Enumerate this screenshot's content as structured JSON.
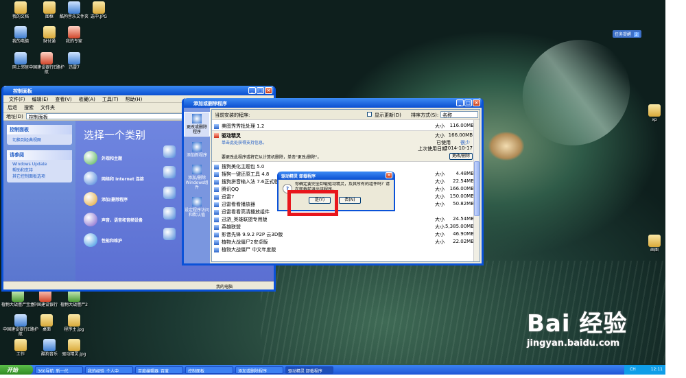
{
  "desktop_icons": [
    {
      "label": "我的文档",
      "tone": ""
    },
    {
      "label": "图框",
      "tone": ""
    },
    {
      "label": "酷狗音乐文件夹",
      "tone": "b"
    },
    {
      "label": "选中.JPG",
      "tone": ""
    },
    {
      "label": "我的电脑",
      "tone": "b"
    },
    {
      "label": "财付通",
      "tone": ""
    },
    {
      "label": "我的专家",
      "tone": "r"
    },
    {
      "label": "网上邻居",
      "tone": "b"
    },
    {
      "label": "中国建设银行E路护航",
      "tone": "r"
    },
    {
      "label": "迅雷7",
      "tone": "b"
    },
    {
      "label": "植物大战僵尸宝盒",
      "tone": "g"
    },
    {
      "label": "中国建设银行",
      "tone": "r"
    },
    {
      "label": "植物大战僵尸2",
      "tone": "g"
    },
    {
      "label": "中国建设银行E路护航",
      "tone": "b"
    },
    {
      "label": "桌面",
      "tone": ""
    },
    {
      "label": "程序主.jpg",
      "tone": ""
    },
    {
      "label": "工作",
      "tone": ""
    },
    {
      "label": "酷狗音乐",
      "tone": "b"
    },
    {
      "label": "驱动精灵.jpg",
      "tone": ""
    },
    {
      "label": "xp",
      "tone": ""
    },
    {
      "label": "画图",
      "tone": ""
    }
  ],
  "gadget": {
    "label": "任务提醒",
    "count": "2"
  },
  "control_panel": {
    "title": "控制面板",
    "menu": [
      "文件(F)",
      "编辑(E)",
      "查看(V)",
      "收藏(A)",
      "工具(T)",
      "帮助(H)"
    ],
    "toolbar": [
      "后退",
      "搜索",
      "文件夹"
    ],
    "address_label": "地址(D)",
    "address_value": "控制面板",
    "side_header": "控制面板",
    "side_link": "切换到经典视图",
    "also_header": "请参阅",
    "also_links": [
      "Windows Update",
      "帮助和支持",
      "其它控制面板选项"
    ],
    "heading": "选择一个类别",
    "categories": [
      "外观和主题",
      "网络和 Internet 连接",
      "添加/删除程序",
      "声音、语音和音频设备",
      "性能和维护"
    ],
    "status": "我的电脑"
  },
  "add_remove": {
    "title": "添加或删除程序",
    "nav": [
      "更改或删除程序",
      "添加新程序",
      "添加/删除Windows组件",
      "设定程序访问和默认值"
    ],
    "installed_label": "当前安装的程序:",
    "show_updates": "显示更新(D)",
    "sort_label": "排序方式(S):",
    "sort_value": "名称",
    "size_word": "大小",
    "rows_top": [
      {
        "name": "美图秀秀批处理 1.2",
        "size": "116.00MB"
      }
    ],
    "selected": {
      "name": "驱动精灵",
      "size": "166.00MB",
      "freq_label": "已使用",
      "freq_value": "很少",
      "last_label": "上次使用日期",
      "last_value": "2014-10-17",
      "support": "单击此处获得支持信息。",
      "desc": "要更改此程序或将它从计算机删除，单击\"更改/删除\"。",
      "button": "更改/删除"
    },
    "rows": [
      {
        "name": "搜狗美化主题包 5.0",
        "size": ""
      },
      {
        "name": "搜狗一键还原工具 4.8",
        "size": "4.48MB"
      },
      {
        "name": "搜狗拼音输入法 7.6正式版",
        "size": "22.54MB"
      },
      {
        "name": "腾讯QQ",
        "size": "166.00MB"
      },
      {
        "name": "迅雷7",
        "size": "150.00MB"
      },
      {
        "name": "迅雷看看播放器",
        "size": "50.82MB"
      },
      {
        "name": "迅雷看看高清播放组件",
        "size": ""
      },
      {
        "name": "迅游_英雄联盟专用版",
        "size": "24.54MB"
      },
      {
        "name": "英雄联盟",
        "size": "5,385.00MB"
      },
      {
        "name": "影音先锋 9.9.2 P2P 云3D版",
        "size": "46.90MB"
      },
      {
        "name": "植物大战僵尸2安卓版",
        "size": "22.02MB"
      },
      {
        "name": "植物大战僵尸 中文年度版",
        "size": ""
      }
    ]
  },
  "dialog": {
    "title": "驱动精灵 卸载程序",
    "message": "你确定要完全卸载驱动精灵，及其所有的组件吗？请在卸载前退出该程序。",
    "yes": "是(Y)",
    "no": "否(N)"
  },
  "taskbar": {
    "start": "开始",
    "items": [
      "360导航_新一代",
      "我的经验_个人中",
      "百度编辑器_百度",
      "控制面板",
      "添加或删除程序",
      "驱动精灵 卸载程序"
    ],
    "active_index": 5,
    "tray_text": "CH",
    "time": "12:11"
  },
  "watermark": {
    "brand": "Bai 经验",
    "url": "jingyan.baidu.com"
  },
  "colors": {
    "titlebar": "#0a52d8",
    "highlight": "#e8161c",
    "taskbar": "#2459d8"
  }
}
